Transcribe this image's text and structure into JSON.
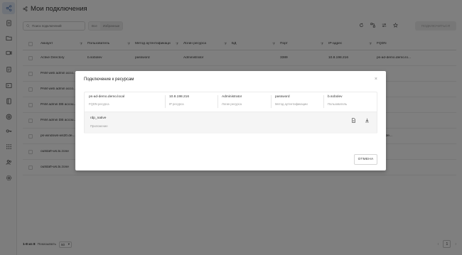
{
  "page": {
    "title": "Мои подключения"
  },
  "sidebar": {
    "items": [
      {
        "icon": "share-icon",
        "active": true
      },
      {
        "icon": "document-icon"
      },
      {
        "icon": "folder-icon"
      },
      {
        "icon": "video-icon"
      },
      {
        "icon": "clipboard-icon"
      },
      {
        "icon": "terminal-icon"
      },
      {
        "icon": "book-icon"
      },
      {
        "icon": "target-icon"
      },
      {
        "icon": "key-icon"
      },
      {
        "icon": "apps-grid-icon"
      },
      {
        "icon": "users-icon"
      },
      {
        "icon": "settings-icon"
      }
    ]
  },
  "toolbar": {
    "search_placeholder": "Поиск подключений",
    "filter_all": "Все",
    "filter_favorites": "Избранные",
    "connect_label": "ПОДКЛЮЧИТЬСЯ"
  },
  "table": {
    "columns": [
      "Аккаунт",
      "Пользователь",
      "Метод аутентификаци",
      "Логин ресурса",
      "БД",
      "Порт",
      "IP-адрес",
      "FQDN"
    ],
    "rows": [
      [
        "Active Directory",
        "b.sobolev",
        "password",
        "Administrator",
        "",
        "3389",
        "10.8.198.216",
        "ps-ad-demo.demo.lo..."
      ],
      [
        "PAM web admin acco...",
        "",
        "",
        "",
        "",
        "",
        "",
        "corp"
      ],
      [
        "PAM web admin acco...",
        "",
        "",
        "",
        "",
        "",
        "",
        "corp"
      ],
      [
        "PAM admin DB accou...",
        "",
        "",
        "",
        "",
        "",
        "",
        "corp"
      ],
      [
        "PAM admin DB accou...",
        "",
        "",
        "",
        "",
        "",
        "",
        "corp"
      ],
      [
        "ps-windows-ws20.de...",
        "",
        "",
        "",
        "",
        "",
        "",
        "ws20.de..."
      ],
      [
        "outstaff-ws.bi.zone",
        "",
        "",
        "",
        "",
        "",
        "",
        ".zone"
      ],
      [
        "outstaff-ws.bi.zone",
        "",
        "",
        "",
        "",
        "",
        "",
        ".zone"
      ]
    ]
  },
  "footer": {
    "range": "1-8 из 8",
    "show_label": "Показывать",
    "page_size": "50",
    "current_page": "1"
  },
  "modal": {
    "title": "Подключение к ресурсам",
    "resource": {
      "fqdn": "ps-ad-demo.demo.local",
      "fqdn_label": "FQDN ресурса",
      "ip": "10.8.198.216",
      "ip_label": "IP ресурса",
      "login": "Administrator",
      "login_label": "Логин ресурса",
      "auth": "password",
      "auth_label": "Метод аутентификации",
      "user": "b.sobolev",
      "user_label": "Пользователь"
    },
    "app": {
      "name": "rdp_native",
      "label": "Приложение"
    },
    "cancel_label": "ОТМЕНА"
  }
}
